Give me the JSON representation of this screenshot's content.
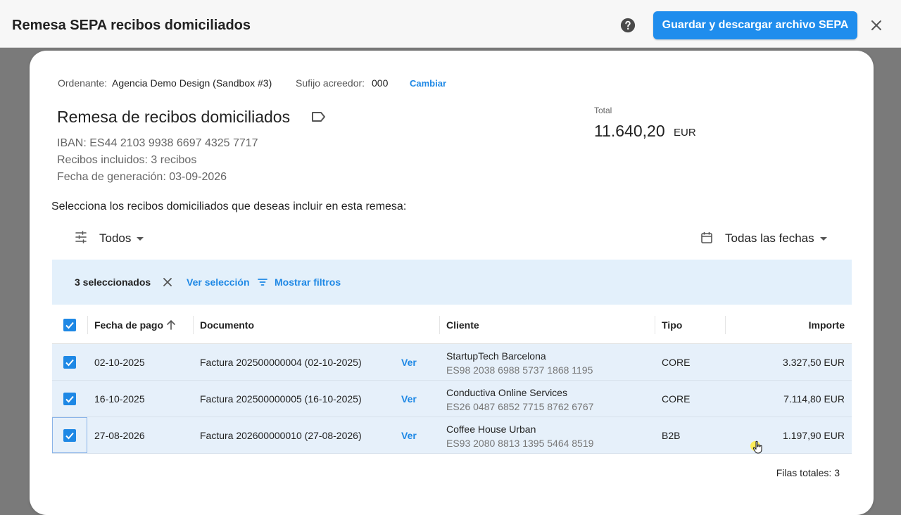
{
  "header": {
    "title": "Remesa SEPA recibos domiciliados",
    "primary_action": "Guardar y descargar archivo SEPA",
    "help_icon": "help-circle-icon",
    "close_icon": "close-icon"
  },
  "ordenante": {
    "label": "Ordenante:",
    "value": "Agencia Demo Design (Sandbox #3)",
    "sufijo_label": "Sufijo acreedor:",
    "sufijo_value": "000",
    "change_link": "Cambiar"
  },
  "remesa": {
    "title": "Remesa de recibos domiciliados",
    "tag_icon": "label-tag-icon",
    "iban": "IBAN: ES44 2103 9938 6697 4325 7717",
    "recibos": "Recibos incluidos: 3 recibos",
    "fecha": "Fecha de generación: 03-09-2026"
  },
  "total": {
    "label": "Total",
    "value": "11.640,20",
    "currency": "EUR"
  },
  "prompt": "Selecciona los recibos domiciliados que deseas incluir en esta remesa:",
  "filters": {
    "status_filter": "Todos",
    "date_filter": "Todas las fechas"
  },
  "selection": {
    "count": "3 seleccionados",
    "view_link": "Ver selección",
    "filters_link": "Mostrar filtros"
  },
  "table": {
    "headers": {
      "fecha": "Fecha de pago",
      "documento": "Documento",
      "cliente": "Cliente",
      "tipo": "Tipo",
      "importe": "Importe"
    },
    "rows": [
      {
        "fecha": "02-10-2025",
        "documento": "Factura 202500000004 (02-10-2025)",
        "ver": "Ver",
        "cliente": "StartupTech Barcelona",
        "iban": "ES98 2038 6988 5737 1868 1195",
        "tipo": "CORE",
        "importe": "3.327,50 EUR",
        "checked": true
      },
      {
        "fecha": "16-10-2025",
        "documento": "Factura 202500000005 (16-10-2025)",
        "ver": "Ver",
        "cliente": "Conductiva Online Services",
        "iban": "ES26 0487 6852 7715 8762 6767",
        "tipo": "CORE",
        "importe": "7.114,80 EUR",
        "checked": true
      },
      {
        "fecha": "27-08-2026",
        "documento": "Factura 202600000010 (27-08-2026)",
        "ver": "Ver",
        "cliente": "Coffee House Urban",
        "iban": "ES93 2080 8813 1395 5464 8519",
        "tipo": "B2B",
        "importe": "1.197,90 EUR",
        "checked": true
      }
    ],
    "footer": "Filas totales: 3"
  },
  "colors": {
    "accent": "#1e88e5",
    "selection_bg": "#e3f0fb",
    "row_selected_bg": "#e6f0fa"
  }
}
